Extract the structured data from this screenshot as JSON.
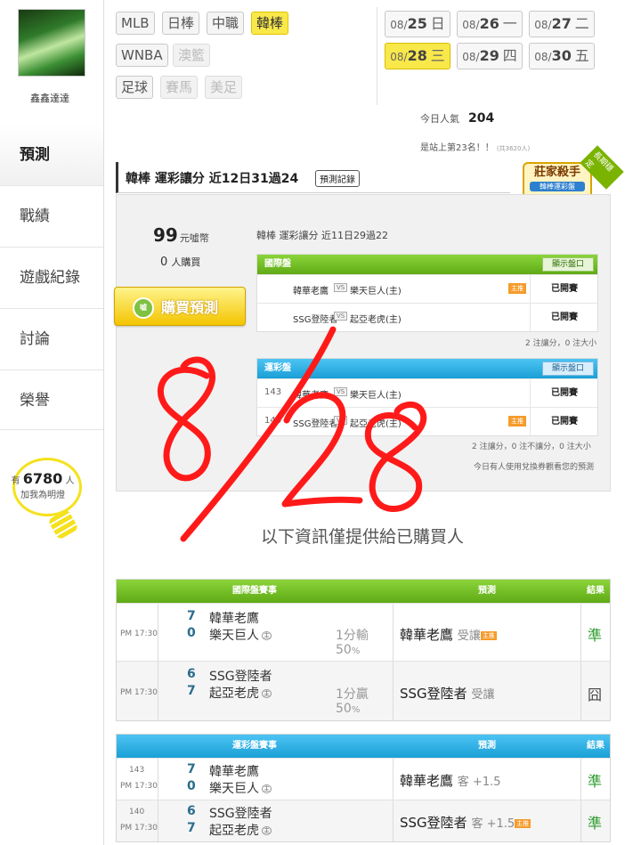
{
  "sidebar": {
    "username": "鑫鑫達達",
    "items": [
      {
        "label": "預測",
        "active": true
      },
      {
        "label": "戰績",
        "active": false
      },
      {
        "label": "遊戲紀錄",
        "active": false
      },
      {
        "label": "討論",
        "active": false
      },
      {
        "label": "榮譽",
        "active": false
      }
    ],
    "fans": {
      "prefix": "有",
      "count": "6780",
      "suffix": "人",
      "line2": "加我為明燈"
    }
  },
  "sports": {
    "row1": [
      "MLB",
      "日棒",
      "中職",
      "韓棒"
    ],
    "row2": [
      "WNBA",
      "澳籃"
    ],
    "row3": [
      "足球",
      "賽馬",
      "美足"
    ],
    "selected": "韓棒"
  },
  "dates": [
    {
      "md": "08/",
      "day": "25",
      "wd": "日"
    },
    {
      "md": "08/",
      "day": "26",
      "wd": "一"
    },
    {
      "md": "08/",
      "day": "27",
      "wd": "二"
    },
    {
      "md": "08/",
      "day": "28",
      "wd": "三",
      "selected": true
    },
    {
      "md": "08/",
      "day": "29",
      "wd": "四"
    },
    {
      "md": "08/",
      "day": "30",
      "wd": "五"
    }
  ],
  "popularity": {
    "label": "今日人氣",
    "value": "204",
    "rank": "是站上第23名！！",
    "total": "(共3620人)"
  },
  "header": {
    "title": "韓棒 運彩讓分 近12日31過24",
    "record_btn": "預測記錄"
  },
  "badge": {
    "line1": "莊家殺手",
    "line2": "韓棒運彩盤",
    "ribbon": "長期穩定"
  },
  "purchase": {
    "coins": "99",
    "coins_unit": "元噓幣",
    "buyers": "0",
    "buyers_unit": "人購買",
    "button": "購買預測",
    "icon_text": "噓"
  },
  "preview": {
    "subtitle": "韓棒 運彩讓分 近11日29過22",
    "intl": {
      "title": "國際盤",
      "show": "顯示盤口",
      "rows": [
        {
          "num": "",
          "t1": "韓華老鷹",
          "vs": "VS",
          "t2": "樂天巨人(主)",
          "mark": "主推",
          "status": "已開賽"
        },
        {
          "num": "",
          "t1": "SSG登陸者",
          "vs": "VS",
          "t2": "起亞老虎(主)",
          "mark": "",
          "status": "已開賽"
        }
      ],
      "note": "2 注讓分，0 注大小"
    },
    "lottery": {
      "title": "運彩盤",
      "show": "顯示盤口",
      "rows": [
        {
          "num": "143",
          "t1": "韓華老鷹",
          "vs": "VS",
          "t2": "樂天巨人(主)",
          "mark": "",
          "status": "已開賽"
        },
        {
          "num": "140",
          "t1": "SSG登陸者",
          "vs": "VS",
          "t2": "起亞老虎(主)",
          "mark": "主推",
          "status": "已開賽"
        }
      ],
      "note": "2 注讓分，0 注不讓分，0 注大小",
      "note2": "今日有人使用兌換券觀看您的預測"
    }
  },
  "only_buyers": "以下資訊僅提供給已購買人",
  "intl_table": {
    "headers": [
      "國際盤賽事",
      "預測",
      "結果"
    ],
    "rows": [
      {
        "num": "",
        "time": "PM 17:30",
        "s1": "7",
        "s2": "0",
        "t1": "韓華老鷹",
        "t2": "樂天巨人",
        "home": "主",
        "hc1": "1分輸",
        "hc2": "50",
        "hc_unit": "%",
        "pred": "韓華老鷹",
        "pred_sub": "受讓",
        "lab": "主推",
        "result": "準",
        "result_type": "ok"
      },
      {
        "num": "",
        "time": "PM 17:30",
        "s1": "6",
        "s2": "7",
        "t1": "SSG登陸者",
        "t2": "起亞老虎",
        "home": "主",
        "hc1": "1分贏",
        "hc2": "50",
        "hc_unit": "%",
        "pred": "SSG登陸者",
        "pred_sub": "受讓",
        "lab": "",
        "result": "囧",
        "result_type": "bad"
      }
    ]
  },
  "lottery_table": {
    "headers": [
      "運彩盤賽事",
      "預測",
      "結果"
    ],
    "rows": [
      {
        "num": "143",
        "time": "PM 17:30",
        "s1": "7",
        "s2": "0",
        "t1": "韓華老鷹",
        "t2": "樂天巨人",
        "home": "主",
        "pred": "韓華老鷹",
        "pred_sub": "客 +1.5",
        "lab": "",
        "result": "準",
        "result_type": "ok"
      },
      {
        "num": "140",
        "time": "PM 17:30",
        "s1": "6",
        "s2": "7",
        "t1": "SSG登陸者",
        "t2": "起亞老虎",
        "home": "主",
        "pred": "SSG登陸者",
        "pred_sub": "客 +1.5",
        "lab": "主推",
        "result": "準",
        "result_type": "ok"
      }
    ]
  },
  "annotation": {
    "text": "8/28",
    "color": "#ff1a1a"
  },
  "colors": {
    "selected": "#f9e84a",
    "green_header": "#6cbb1f",
    "blue_header": "#1fa7df",
    "win": "#2f9d2f",
    "handwriting": "#ff1a1a"
  }
}
